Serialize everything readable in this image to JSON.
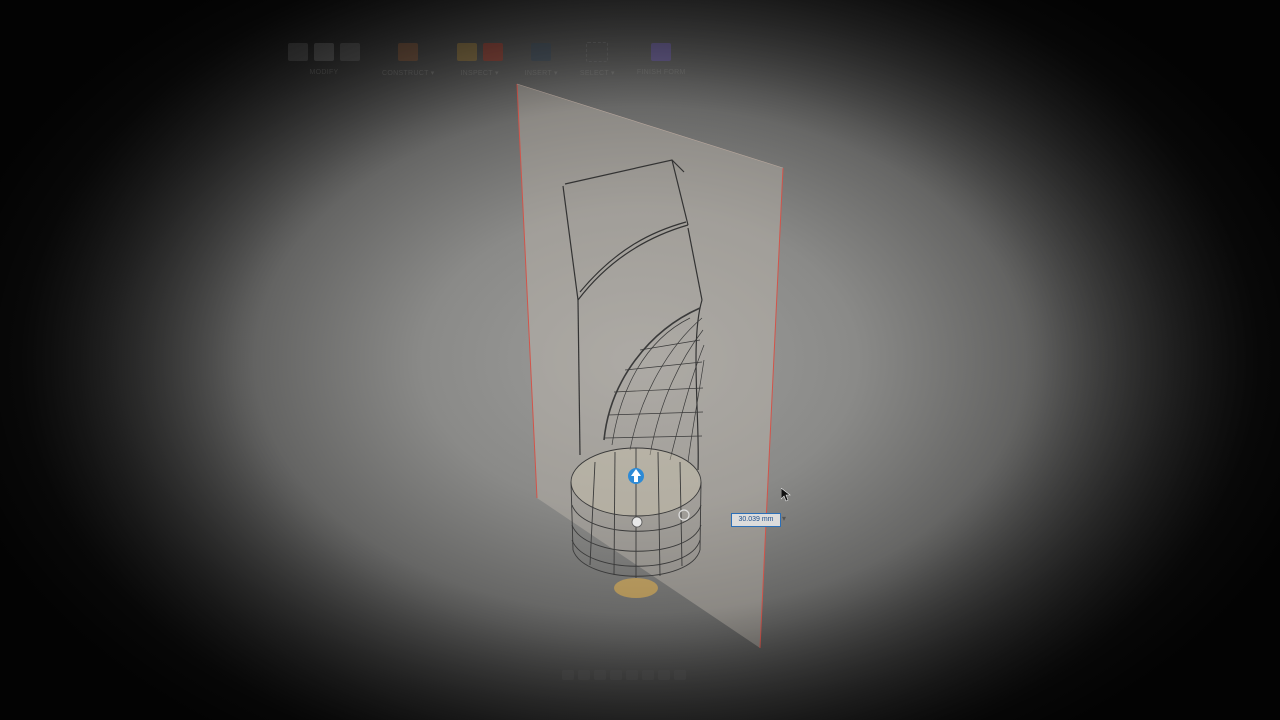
{
  "toolbar": {
    "groups": [
      {
        "label": "MODIFY",
        "icon": "modify-icon"
      },
      {
        "label": "CONSTRUCT ▾",
        "icon": "construct-icon"
      },
      {
        "label": "INSPECT ▾",
        "icon": "inspect-icon"
      },
      {
        "label": "INSERT ▾",
        "icon": "insert-image-icon"
      },
      {
        "label": "SELECT ▾",
        "icon": "select-icon"
      },
      {
        "label": "FINISH FORM",
        "icon": "finish-form-icon"
      }
    ]
  },
  "dimension_input": {
    "value": "30.039 mm"
  },
  "colors": {
    "plane_fill": "#c9bfb6",
    "plane_edge": "#d2544a",
    "wire": "#3a3a3a",
    "manipulator_blue": "#2c8ad6",
    "finish_form_purple": "#7a6ab8"
  }
}
